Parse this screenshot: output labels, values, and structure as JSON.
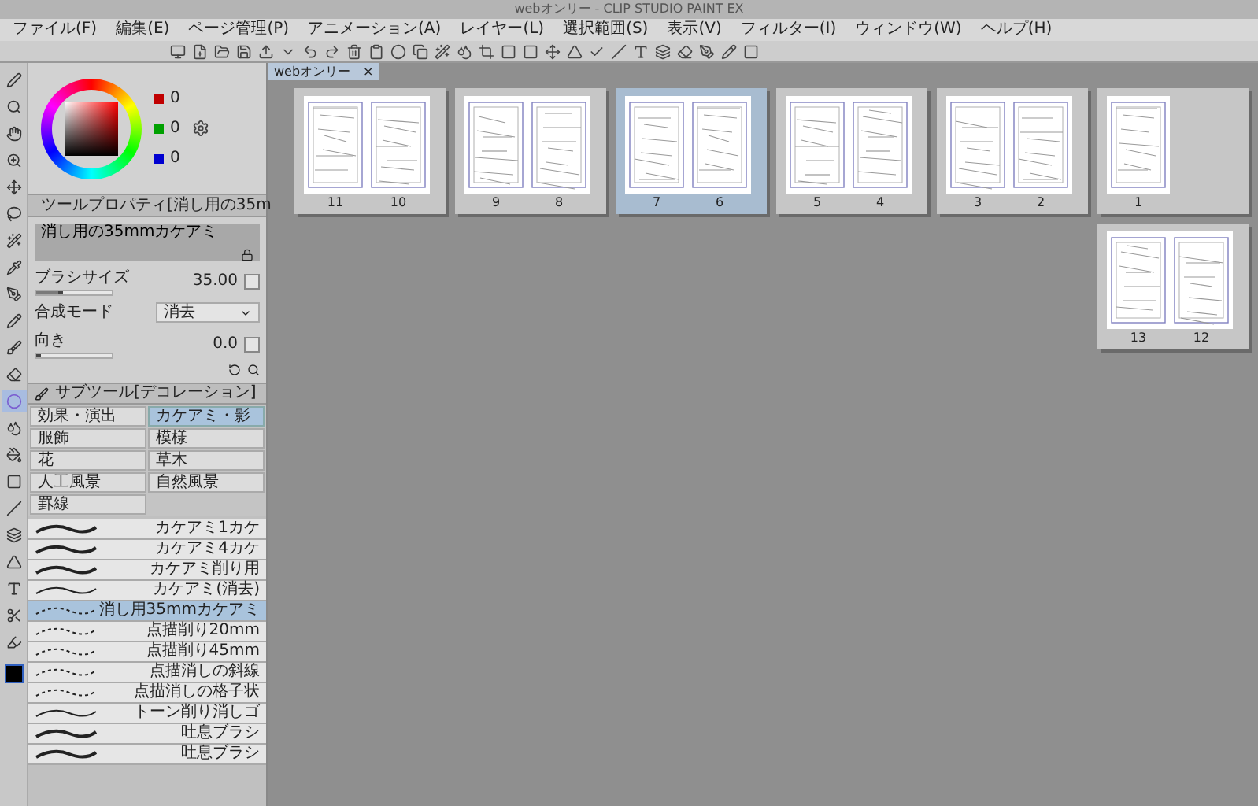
{
  "window": {
    "title": "webオンリー - CLIP STUDIO PAINT EX"
  },
  "menu": [
    "ファイル(F)",
    "編集(E)",
    "ページ管理(P)",
    "アニメーション(A)",
    "レイヤー(L)",
    "選択範囲(S)",
    "表示(V)",
    "フィルター(I)",
    "ウィンドウ(W)",
    "ヘルプ(H)"
  ],
  "tools": [
    {
      "selected": false
    },
    {
      "selected": false
    },
    {
      "selected": false
    },
    {
      "selected": false
    },
    {
      "selected": false
    },
    {
      "selected": false
    },
    {
      "selected": false
    },
    {
      "selected": false
    },
    {
      "selected": false
    },
    {
      "selected": false
    },
    {
      "selected": false
    },
    {
      "selected": false
    },
    {
      "selected": true
    },
    {
      "selected": false
    },
    {
      "selected": false
    },
    {
      "selected": false
    },
    {
      "selected": false
    },
    {
      "selected": false
    },
    {
      "selected": false
    },
    {
      "selected": false
    },
    {
      "selected": false
    },
    {
      "selected": false
    }
  ],
  "color": {
    "values": [
      "0",
      "0",
      "0"
    ]
  },
  "tool_property": {
    "header": "ツールプロパティ[消し用の35m",
    "preset": "消し用の35mmカケアミ",
    "rows": [
      {
        "kind": "number",
        "label": "ブラシサイズ",
        "value": "35.00",
        "level": 0.3
      },
      {
        "kind": "dropdown",
        "label": "合成モード",
        "value": "消去"
      },
      {
        "kind": "number",
        "label": "向き",
        "value": "0.0",
        "level": 0.0
      }
    ]
  },
  "sub_tool": {
    "header": "サブツール[デコレーション]",
    "groups": [
      {
        "label": "効果・演出",
        "selected": false
      },
      {
        "label": "カケアミ・影",
        "selected": true
      },
      {
        "label": "服飾",
        "selected": false
      },
      {
        "label": "模様",
        "selected": false
      },
      {
        "label": "花",
        "selected": false
      },
      {
        "label": "草木",
        "selected": false
      },
      {
        "label": "人工風景",
        "selected": false
      },
      {
        "label": "自然風景",
        "selected": false
      },
      {
        "label": "罫線",
        "selected": false
      }
    ],
    "brushes": [
      {
        "name": "カケアミ1カケ",
        "selected": false
      },
      {
        "name": "カケアミ4カケ",
        "selected": false
      },
      {
        "name": "カケアミ削り用",
        "selected": false
      },
      {
        "name": "カケアミ(消去)",
        "selected": false
      },
      {
        "name": "消し用35mmカケアミ",
        "selected": true
      },
      {
        "name": "点描削り20mm",
        "selected": false
      },
      {
        "name": "点描削り45mm",
        "selected": false
      },
      {
        "name": "点描消しの斜線",
        "selected": false
      },
      {
        "name": "点描消しの格子状",
        "selected": false
      },
      {
        "name": "トーン削り消しゴ",
        "selected": false
      },
      {
        "name": "吐息ブラシ",
        "selected": false
      },
      {
        "name": "吐息ブラシ",
        "selected": false
      }
    ]
  },
  "document_tab": {
    "title": "webオンリー",
    "close": "×"
  },
  "spreads": [
    {
      "pages": [
        "11",
        "10"
      ],
      "selected": false
    },
    {
      "pages": [
        "9",
        "8"
      ],
      "selected": false
    },
    {
      "pages": [
        "7",
        "6"
      ],
      "selected": true
    },
    {
      "pages": [
        "5",
        "4"
      ],
      "selected": false
    },
    {
      "pages": [
        "3",
        "2"
      ],
      "selected": false
    },
    {
      "pages": [
        "1"
      ],
      "selected": false
    },
    {
      "pages": [
        "13",
        "12"
      ],
      "selected": false
    }
  ]
}
